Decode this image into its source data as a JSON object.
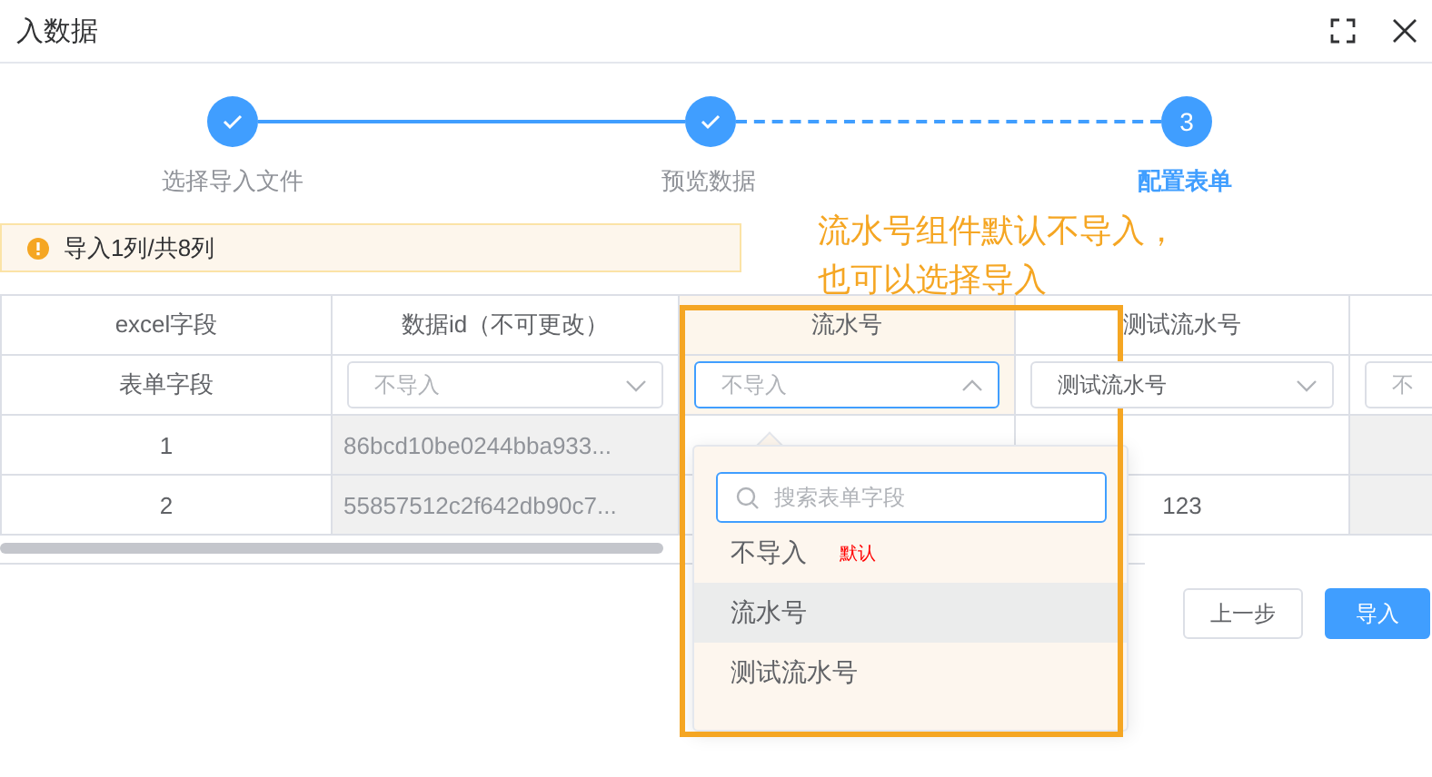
{
  "dialog": {
    "title": "入数据"
  },
  "steps": [
    {
      "label": "选择导入文件",
      "done": true,
      "active": false
    },
    {
      "label": "预览数据",
      "done": true,
      "active": false
    },
    {
      "label": "配置表单",
      "number": "3",
      "done": false,
      "active": true
    }
  ],
  "alert": {
    "text": "导入1列/共8列"
  },
  "annotation": {
    "lines": [
      "流水号组件默认不导入，",
      "也可以选择导入"
    ]
  },
  "table": {
    "columns": [
      {
        "title": "excel字段",
        "disabled": false,
        "annotated": false
      },
      {
        "title": "数据id（不可更改）",
        "disabled": true,
        "annotated": false
      },
      {
        "title": "流水号",
        "disabled": false,
        "annotated": true
      },
      {
        "title": "测试流水号",
        "disabled": false,
        "annotated": false
      },
      {
        "disabled": true,
        "annotated": false
      }
    ],
    "mapping_label": "表单字段",
    "selects": [
      {
        "placeholder": "不导入",
        "open": false
      },
      {
        "placeholder": "不导入",
        "open": true
      },
      {
        "value": "测试流水号",
        "open": false
      },
      {
        "placeholder": "不"
      }
    ],
    "rows": [
      {
        "cells": [
          "1",
          "86bcd10be0244bba933..."
        ]
      },
      {
        "cells": [
          "2",
          "55857512c2f642db90c7...",
          null,
          "123"
        ]
      }
    ]
  },
  "dropdown": {
    "search_placeholder": "搜索表单字段",
    "options": [
      {
        "label": "不导入",
        "tag": "默认",
        "highlighted": false
      },
      {
        "label": "流水号",
        "highlighted": true
      },
      {
        "label": "测试流水号",
        "highlighted": false
      }
    ]
  },
  "buttons": [
    {
      "label": "上一步",
      "kind": "default"
    },
    {
      "label": "导入",
      "kind": "primary"
    }
  ]
}
